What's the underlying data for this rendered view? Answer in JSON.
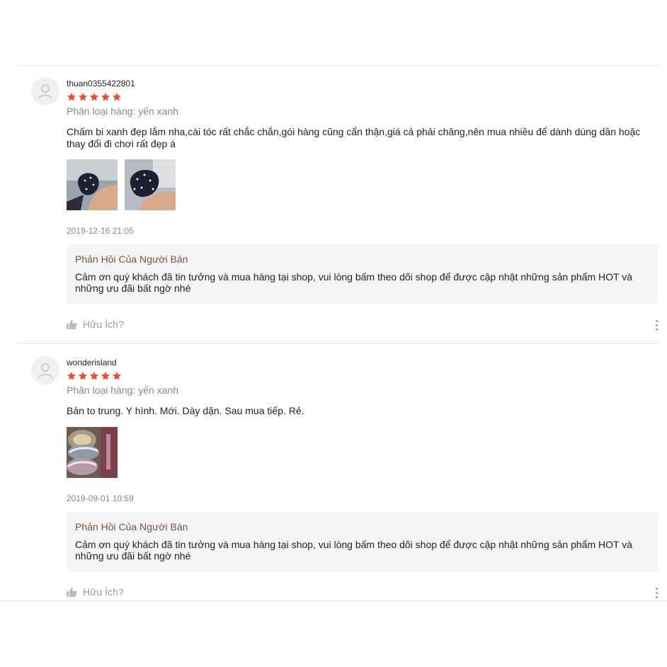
{
  "reviews": [
    {
      "username": "thuan0355422801",
      "rating": 5,
      "variant": "Phân loại hàng: yến xanh",
      "comment": "Chấm bi xanh đẹp lắm nha,cài tóc rất chắc chắn,gói hàng cũng cẩn thận,giá cả phải chăng,nên mua nhiều để dành dùng dần hoặc thay đổi đi chơi rất đẹp á",
      "date": "2019-12-16 21:05",
      "reply_title": "Phản Hồi Của Người Bán",
      "reply_text": "Cảm ơn quý khách đã tin tưởng và mua hàng tại shop, vui lòng bấm theo dõi shop để được cập nhật những sản phẩm HOT và những ưu đãi bất ngờ nhé",
      "helpful": "Hữu Ích?"
    },
    {
      "username": "wonderisland",
      "rating": 5,
      "variant": "Phân loại hàng: yến xanh",
      "comment": "Bản to trung. Y hình. Mới. Dày dặn. Sau mua tiếp. Rẻ.",
      "date": "2019-09-01 10:59",
      "reply_title": "Phản Hồi Của Người Bán",
      "reply_text": "Cảm ơn quý khách đã tin tưởng và mua hàng tại shop, vui lòng bấm theo dõi shop để được cập nhật những sản phẩm HOT và những ưu đãi bất ngờ nhé",
      "helpful": "Hữu Ích?"
    }
  ],
  "colors": {
    "star": "#ee4d2d",
    "reply_title": "#7a5240",
    "reply_bg": "#f5f5f5"
  }
}
